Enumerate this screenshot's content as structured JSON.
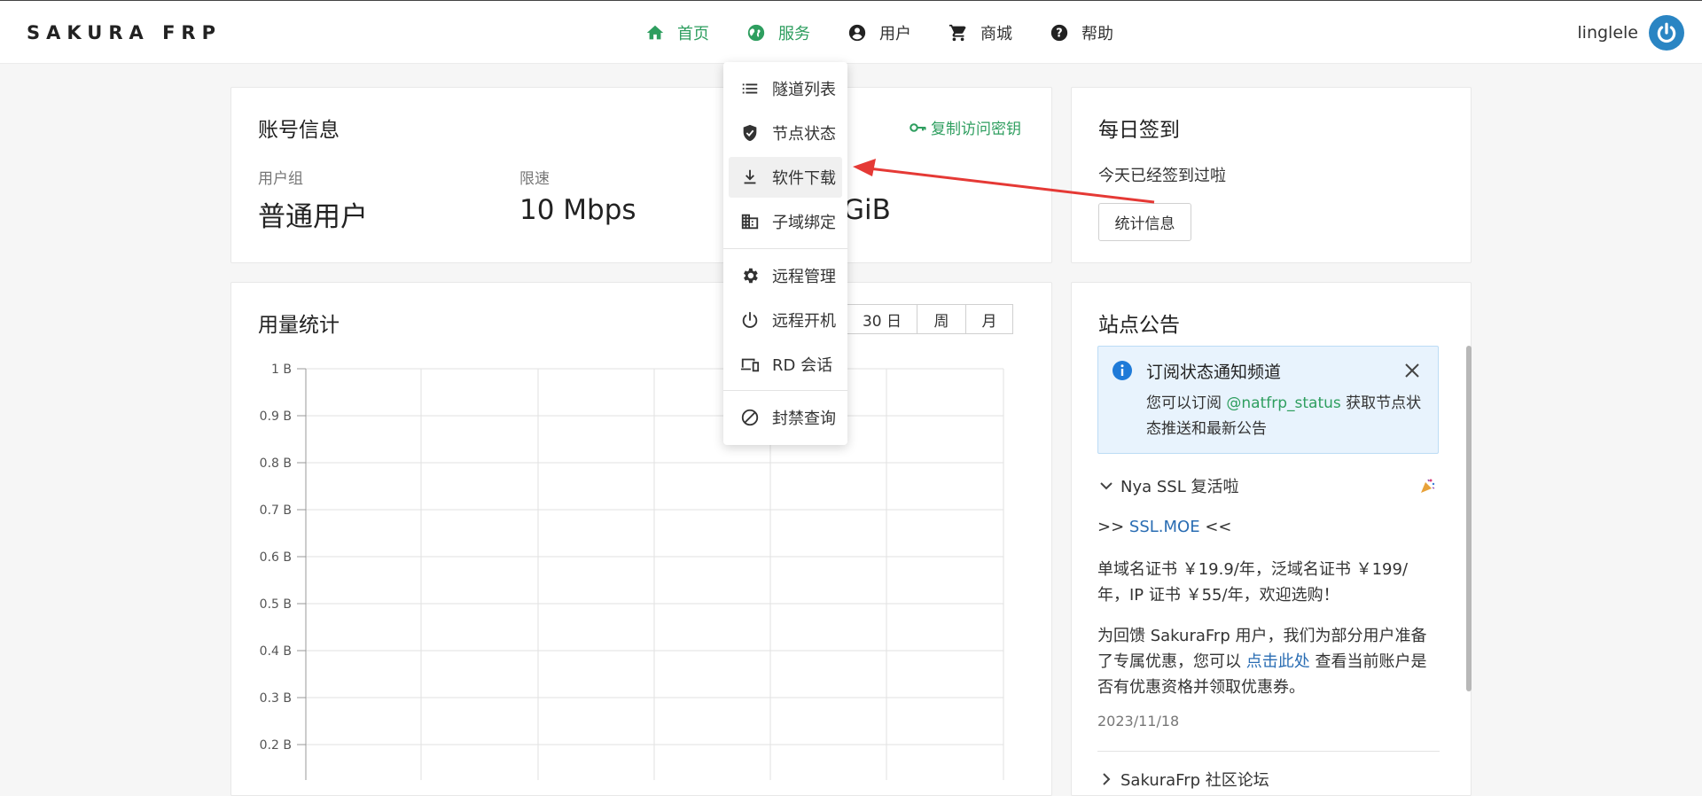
{
  "brand": "SAKURA FRP",
  "nav": {
    "home": "首页",
    "services": "服务",
    "user": "用户",
    "shop": "商城",
    "help": "帮助"
  },
  "username": "linglele",
  "account": {
    "title": "账号信息",
    "copy_key": "复制访问密钥",
    "group_label": "用户组",
    "group_value": "普通用户",
    "speed_label": "限速",
    "speed_value": "10 Mbps",
    "traffic_value_partial": "GiB"
  },
  "checkin": {
    "title": "每日签到",
    "status": "今天已经签到过啦",
    "stats_button": "统计信息"
  },
  "usage": {
    "title": "用量统计",
    "ranges": [
      "30 日",
      "周",
      "月"
    ]
  },
  "chart_data": {
    "type": "line",
    "title": "",
    "ylim": [
      0,
      1
    ],
    "yticks": [
      "1 B",
      "0.9 B",
      "0.8 B",
      "0.7 B",
      "0.6 B",
      "0.5 B",
      "0.4 B",
      "0.3 B",
      "0.2 B"
    ],
    "series": []
  },
  "announcements": {
    "title": "站点公告",
    "notice_title": "订阅状态通知频道",
    "notice_text_1": "您可以订阅",
    "notice_handle": "@natfrp_status",
    "notice_text_2": "获取节点状",
    "notice_text_3": "态推送和最新公告",
    "item1_title": "Nya SSL 复活啦",
    "item1_link_prefix": ">>",
    "item1_link": "SSL.MOE",
    "item1_link_suffix": "<<",
    "item1_p1_line1": "单域名证书 ￥19.9/年，泛域名证书 ￥199/",
    "item1_p1_line2": "年，IP 证书 ￥55/年，欢迎选购！",
    "item1_p2_line1": "为回馈 SakuraFrp 用户，我们为部分用户准备",
    "item1_p2_line2a": "了专属优惠，您可以",
    "item1_p2_link": "点击此处",
    "item1_p2_line2b": "查看当前账户是",
    "item1_p2_line3": "否有优惠资格并领取优惠券。",
    "item1_date": "2023/11/18",
    "item2_title": "SakuraFrp 社区论坛"
  },
  "services_menu": {
    "tunnels": "隧道列表",
    "node_status": "节点状态",
    "download": "软件下载",
    "subdomain": "子域绑定",
    "remote_manage": "远程管理",
    "remote_boot": "远程开机",
    "rd_session": "RD 会话",
    "ban_query": "封禁查询"
  },
  "colors": {
    "accent": "#2e9e5f",
    "link": "#2a6db3",
    "arrow": "#e53935",
    "avatar": "#2a85c3"
  }
}
